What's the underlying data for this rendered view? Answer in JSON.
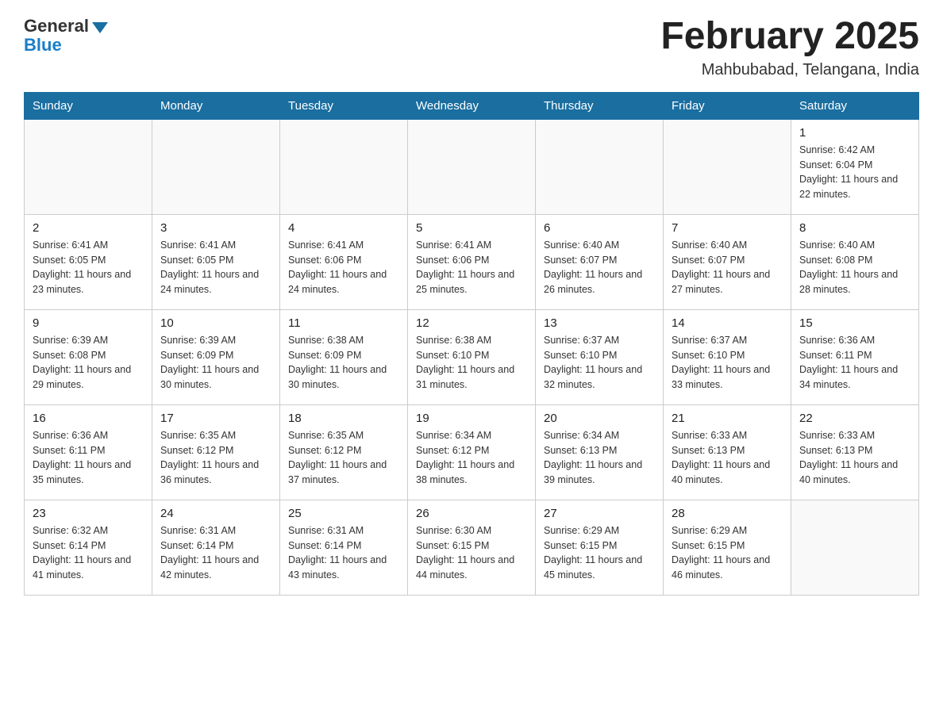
{
  "header": {
    "logo_general": "General",
    "logo_blue": "Blue",
    "month_title": "February 2025",
    "location": "Mahbubabad, Telangana, India"
  },
  "days_of_week": [
    "Sunday",
    "Monday",
    "Tuesday",
    "Wednesday",
    "Thursday",
    "Friday",
    "Saturday"
  ],
  "weeks": [
    [
      {
        "day": "",
        "info": ""
      },
      {
        "day": "",
        "info": ""
      },
      {
        "day": "",
        "info": ""
      },
      {
        "day": "",
        "info": ""
      },
      {
        "day": "",
        "info": ""
      },
      {
        "day": "",
        "info": ""
      },
      {
        "day": "1",
        "info": "Sunrise: 6:42 AM\nSunset: 6:04 PM\nDaylight: 11 hours and 22 minutes."
      }
    ],
    [
      {
        "day": "2",
        "info": "Sunrise: 6:41 AM\nSunset: 6:05 PM\nDaylight: 11 hours and 23 minutes."
      },
      {
        "day": "3",
        "info": "Sunrise: 6:41 AM\nSunset: 6:05 PM\nDaylight: 11 hours and 24 minutes."
      },
      {
        "day": "4",
        "info": "Sunrise: 6:41 AM\nSunset: 6:06 PM\nDaylight: 11 hours and 24 minutes."
      },
      {
        "day": "5",
        "info": "Sunrise: 6:41 AM\nSunset: 6:06 PM\nDaylight: 11 hours and 25 minutes."
      },
      {
        "day": "6",
        "info": "Sunrise: 6:40 AM\nSunset: 6:07 PM\nDaylight: 11 hours and 26 minutes."
      },
      {
        "day": "7",
        "info": "Sunrise: 6:40 AM\nSunset: 6:07 PM\nDaylight: 11 hours and 27 minutes."
      },
      {
        "day": "8",
        "info": "Sunrise: 6:40 AM\nSunset: 6:08 PM\nDaylight: 11 hours and 28 minutes."
      }
    ],
    [
      {
        "day": "9",
        "info": "Sunrise: 6:39 AM\nSunset: 6:08 PM\nDaylight: 11 hours and 29 minutes."
      },
      {
        "day": "10",
        "info": "Sunrise: 6:39 AM\nSunset: 6:09 PM\nDaylight: 11 hours and 30 minutes."
      },
      {
        "day": "11",
        "info": "Sunrise: 6:38 AM\nSunset: 6:09 PM\nDaylight: 11 hours and 30 minutes."
      },
      {
        "day": "12",
        "info": "Sunrise: 6:38 AM\nSunset: 6:10 PM\nDaylight: 11 hours and 31 minutes."
      },
      {
        "day": "13",
        "info": "Sunrise: 6:37 AM\nSunset: 6:10 PM\nDaylight: 11 hours and 32 minutes."
      },
      {
        "day": "14",
        "info": "Sunrise: 6:37 AM\nSunset: 6:10 PM\nDaylight: 11 hours and 33 minutes."
      },
      {
        "day": "15",
        "info": "Sunrise: 6:36 AM\nSunset: 6:11 PM\nDaylight: 11 hours and 34 minutes."
      }
    ],
    [
      {
        "day": "16",
        "info": "Sunrise: 6:36 AM\nSunset: 6:11 PM\nDaylight: 11 hours and 35 minutes."
      },
      {
        "day": "17",
        "info": "Sunrise: 6:35 AM\nSunset: 6:12 PM\nDaylight: 11 hours and 36 minutes."
      },
      {
        "day": "18",
        "info": "Sunrise: 6:35 AM\nSunset: 6:12 PM\nDaylight: 11 hours and 37 minutes."
      },
      {
        "day": "19",
        "info": "Sunrise: 6:34 AM\nSunset: 6:12 PM\nDaylight: 11 hours and 38 minutes."
      },
      {
        "day": "20",
        "info": "Sunrise: 6:34 AM\nSunset: 6:13 PM\nDaylight: 11 hours and 39 minutes."
      },
      {
        "day": "21",
        "info": "Sunrise: 6:33 AM\nSunset: 6:13 PM\nDaylight: 11 hours and 40 minutes."
      },
      {
        "day": "22",
        "info": "Sunrise: 6:33 AM\nSunset: 6:13 PM\nDaylight: 11 hours and 40 minutes."
      }
    ],
    [
      {
        "day": "23",
        "info": "Sunrise: 6:32 AM\nSunset: 6:14 PM\nDaylight: 11 hours and 41 minutes."
      },
      {
        "day": "24",
        "info": "Sunrise: 6:31 AM\nSunset: 6:14 PM\nDaylight: 11 hours and 42 minutes."
      },
      {
        "day": "25",
        "info": "Sunrise: 6:31 AM\nSunset: 6:14 PM\nDaylight: 11 hours and 43 minutes."
      },
      {
        "day": "26",
        "info": "Sunrise: 6:30 AM\nSunset: 6:15 PM\nDaylight: 11 hours and 44 minutes."
      },
      {
        "day": "27",
        "info": "Sunrise: 6:29 AM\nSunset: 6:15 PM\nDaylight: 11 hours and 45 minutes."
      },
      {
        "day": "28",
        "info": "Sunrise: 6:29 AM\nSunset: 6:15 PM\nDaylight: 11 hours and 46 minutes."
      },
      {
        "day": "",
        "info": ""
      }
    ]
  ]
}
